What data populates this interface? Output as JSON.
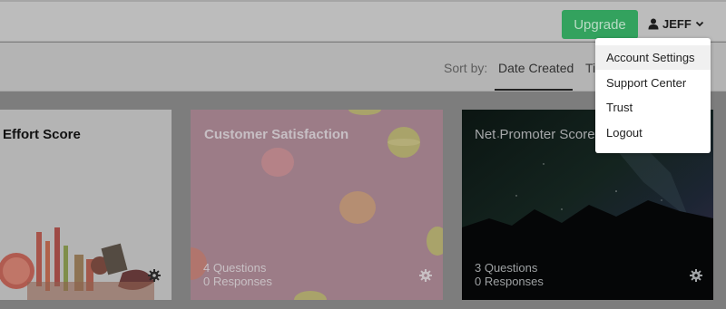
{
  "header": {
    "upgrade_label": "Upgrade",
    "user_name": "JEFF"
  },
  "sort": {
    "label": "Sort by:",
    "active": "Date Created",
    "next_partial": "Ti"
  },
  "cards": [
    {
      "title": "Effort Score",
      "questions": "",
      "responses": ""
    },
    {
      "title": "Customer Satisfaction",
      "questions": "4 Questions",
      "responses": "0 Responses"
    },
    {
      "title": "Net Promoter Score",
      "questions": "3 Questions",
      "responses": "0 Responses"
    }
  ],
  "dropdown": {
    "items": [
      "Account Settings",
      "Support Center",
      "Trust",
      "Logout"
    ]
  },
  "colors": {
    "upgrade": "#33a25e",
    "card_pink": "#9c7c87",
    "card_night": "#0f1316"
  },
  "icons": {
    "user": "user-icon",
    "caret": "chevron-down-icon",
    "settings": "gear-icon"
  }
}
